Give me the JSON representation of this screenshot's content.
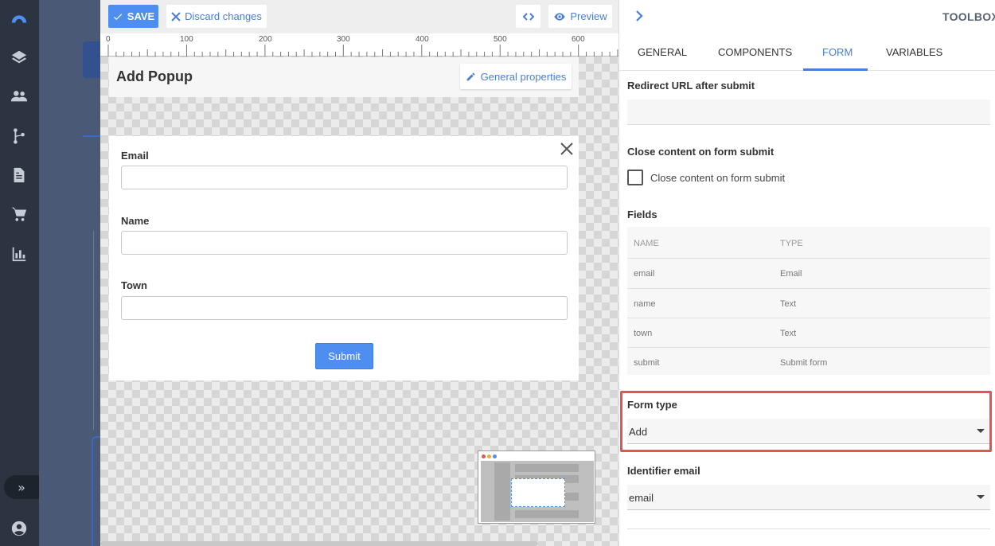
{
  "rail": {
    "icons": [
      "logo-icon",
      "layers-icon",
      "users-icon",
      "branch-icon",
      "document-icon",
      "cart-icon",
      "chart-icon"
    ],
    "expand_glyph": "»",
    "user_icon": "account-icon"
  },
  "editor": {
    "toolbar": {
      "save_label": "SAVE",
      "discard_label": "Discard changes",
      "preview_label": "Preview"
    },
    "ruler_labels": [
      "0",
      "100",
      "200",
      "300",
      "400",
      "500",
      "600"
    ],
    "popup_title": "Add Popup",
    "general_properties_label": "General properties",
    "form": {
      "fields": [
        {
          "label": "Email"
        },
        {
          "label": "Name"
        },
        {
          "label": "Town"
        }
      ],
      "submit_label": "Submit"
    }
  },
  "toolbox": {
    "title": "TOOLBOX",
    "tabs": [
      "GENERAL",
      "COMPONENTS",
      "FORM",
      "VARIABLES"
    ],
    "active_tab": "FORM",
    "redirect_label": "Redirect URL after submit",
    "redirect_value": "",
    "close_content_heading": "Close content on form submit",
    "close_content_checkbox_label": "Close content on form submit",
    "close_content_checked": false,
    "fields_heading": "Fields",
    "fields_columns": [
      "NAME",
      "TYPE"
    ],
    "fields_rows": [
      {
        "name": "email",
        "type": "Email"
      },
      {
        "name": "name",
        "type": "Text"
      },
      {
        "name": "town",
        "type": "Text"
      },
      {
        "name": "submit",
        "type": "Submit form"
      }
    ],
    "form_type_label": "Form type",
    "form_type_value": "Add",
    "identifier_label": "Identifier email",
    "identifier_value": "email"
  },
  "colors": {
    "accent": "#4e8ef0",
    "highlight": "#e9524d",
    "rail": "#2c3441"
  }
}
